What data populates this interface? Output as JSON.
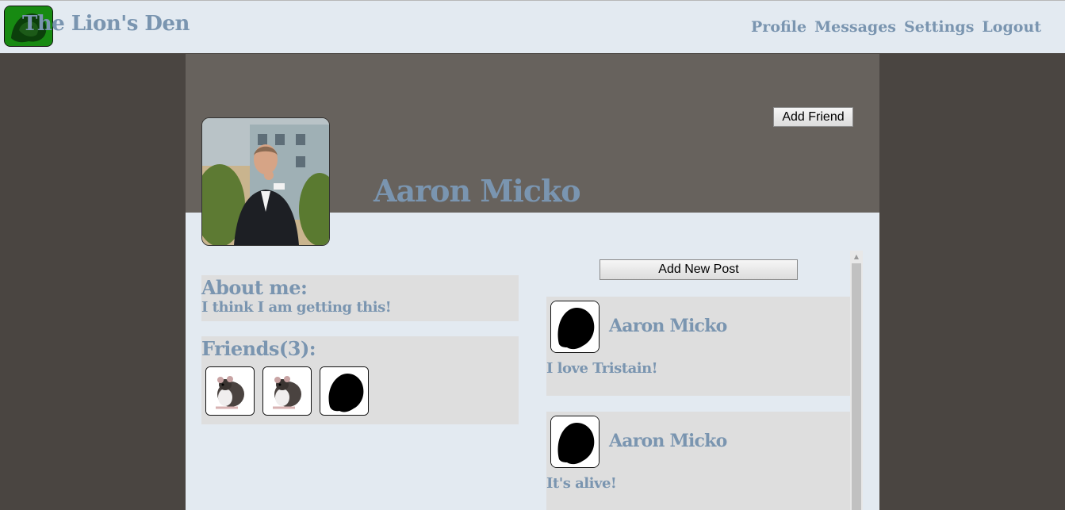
{
  "header": {
    "site_title": "The Lion's Den",
    "nav": [
      "Profile",
      "Messages",
      "Settings",
      "Logout"
    ]
  },
  "profile": {
    "name": "Aaron Micko",
    "add_friend_label": "Add Friend",
    "about": {
      "heading": "About me:",
      "text": "I think I am getting this!"
    },
    "friends": {
      "heading": "Friends(3):",
      "items": [
        {
          "icon": "rat-photo"
        },
        {
          "icon": "rat-photo"
        },
        {
          "icon": "lion-silhouette"
        }
      ]
    }
  },
  "posts": {
    "add_post_label": "Add New Post",
    "items": [
      {
        "author": "Aaron Micko",
        "body": "I love Tristain!"
      },
      {
        "author": "Aaron Micko",
        "body": "It's alive!"
      }
    ]
  },
  "colors": {
    "accent_text": "#7a95b0",
    "header_bg": "#e3eaf1",
    "page_bg": "#4a4541",
    "banner_bg": "#67625d",
    "card_bg": "#dedede"
  }
}
